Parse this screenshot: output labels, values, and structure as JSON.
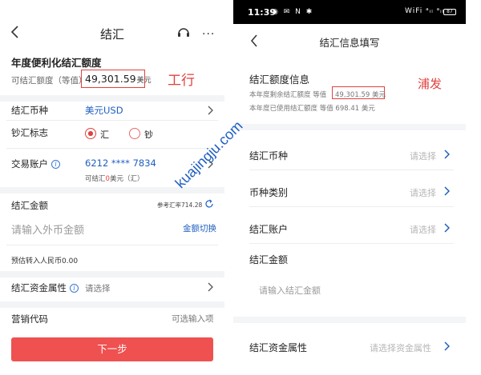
{
  "left": {
    "title": "结汇",
    "more_label": "···",
    "quota_title": "年度便利化结汇额度",
    "quota_label": "可结汇额度（等值）",
    "quota_value": "49,301.59",
    "quota_unit": "美元",
    "bank_annotation": "工行",
    "currency_label": "结汇币种",
    "currency_value": "美元USD",
    "cash_flag_label": "钞汇标志",
    "cash_flag_options": [
      "汇",
      "钞"
    ],
    "cash_flag_selected": "汇",
    "account_label": "交易账户",
    "account_number": "6212 **** 7834",
    "account_sub_prefix": "可结汇",
    "account_sub_zero": "0",
    "account_sub_suffix": "美元（汇）",
    "amount_label": "结汇金额",
    "ref_rate": "参考汇率714.28",
    "amount_placeholder": "请输入外币金额",
    "switch_label": "金额切换",
    "estimate": "预估转入人民币0.00",
    "fund_attr_label": "结汇资金属性",
    "fund_attr_placeholder": "请选择",
    "marketing_label": "营销代码",
    "marketing_placeholder": "可选输入项",
    "next_button": "下一步",
    "colors": {
      "accent": "#e0423f",
      "link": "#1f5fc0",
      "button": "#ee5150"
    }
  },
  "right": {
    "status_time": "11:39",
    "status_left_icons": "◉ ✉ N ✱",
    "status_right_icons": "WiFi ᵃᵢₗ ᵃᵢₗ",
    "battery": "87",
    "title": "结汇信息填写",
    "quota_title": "结汇额度信息",
    "remain_prefix": "本年度剩余结汇额度 等值",
    "remain_value": "49,301.59 美元",
    "used_text": "本年度已使用结汇额度 等值 698.41 美元",
    "bank_annotation": "浦发",
    "rows": [
      {
        "label": "结汇币种",
        "placeholder": "请选择"
      },
      {
        "label": "币种类别",
        "placeholder": "请选择"
      },
      {
        "label": "结汇账户",
        "placeholder": "请选择"
      }
    ],
    "amount_label": "结汇金额",
    "amount_placeholder": "请输入结汇金额",
    "fund_attr_label": "结汇资金属性",
    "fund_attr_placeholder": "请选择资金属性"
  },
  "watermark": "kuajingju.com"
}
